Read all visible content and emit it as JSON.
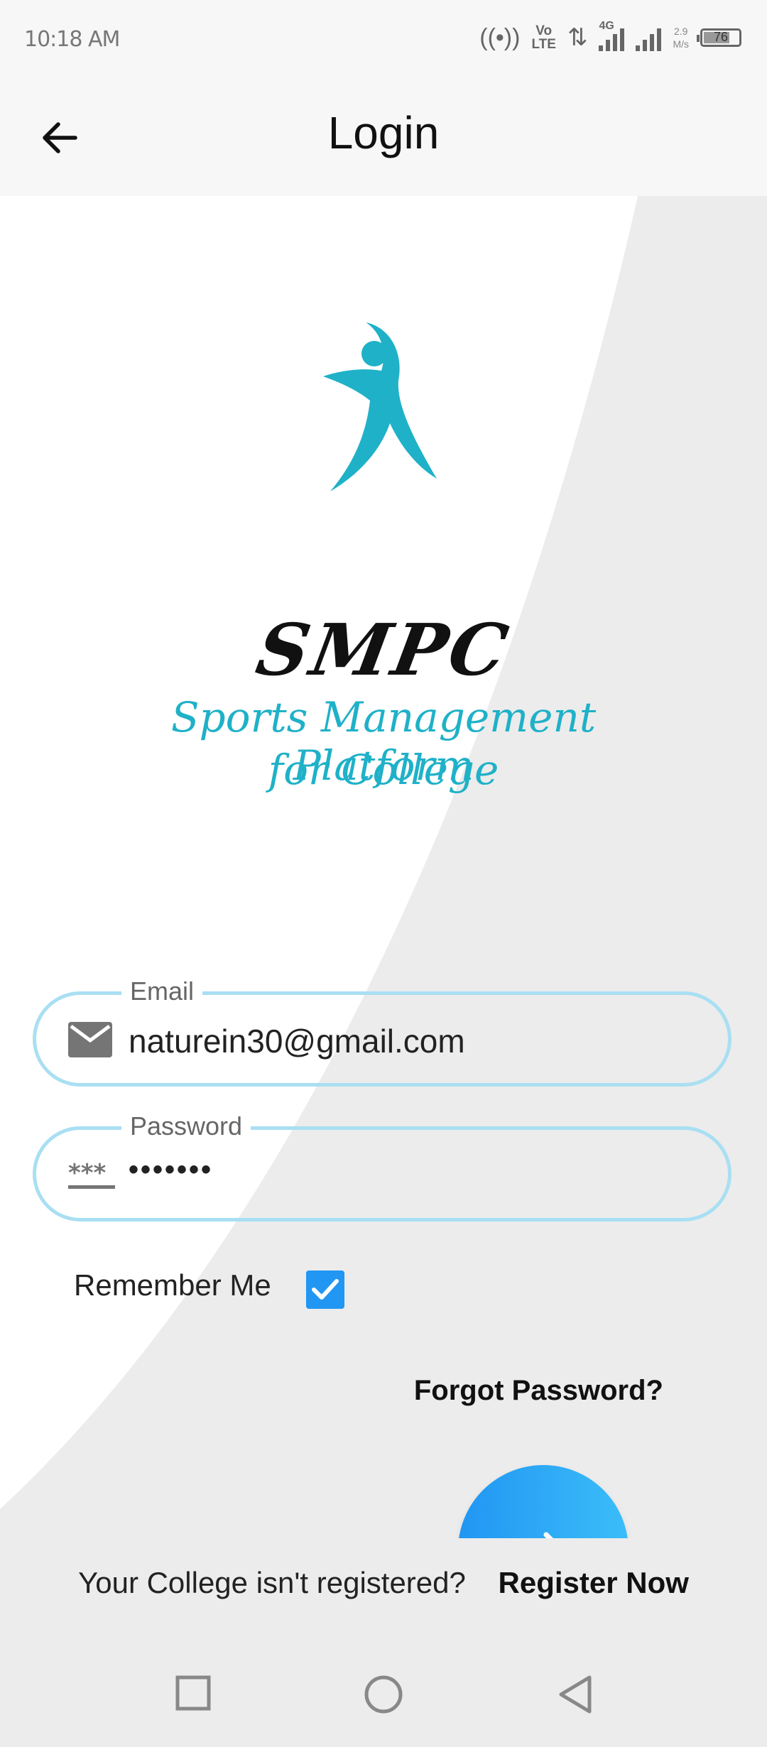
{
  "status_bar": {
    "time": "10:18 AM",
    "volte_top": "Vo",
    "volte_bottom": "LTE",
    "network": "4G",
    "speed_value": "2.9",
    "speed_unit": "M/s",
    "battery": "76"
  },
  "app_bar": {
    "title": "Login"
  },
  "logo": {
    "brand": "SMPC",
    "subtitle_line1": "Sports Management Platform",
    "subtitle_line2": "for College"
  },
  "form": {
    "email_label": "Email",
    "email_value": "naturein30@gmail.com",
    "password_label": "Password",
    "password_value": "•••••••",
    "remember_label": "Remember Me",
    "remember_checked": true,
    "forgot_label": "Forgot Password?"
  },
  "footer": {
    "question": "Your College isn't registered?",
    "register_label": "Register Now"
  },
  "colors": {
    "accent": "#2196f3",
    "field_border": "#a9dff2",
    "logo_teal": "#1fb1c8"
  },
  "icons": {
    "back": "arrow-left-icon",
    "email": "envelope-icon",
    "password": "asterisks-icon",
    "check": "checkmark-icon",
    "submit": "arrow-right-icon"
  }
}
